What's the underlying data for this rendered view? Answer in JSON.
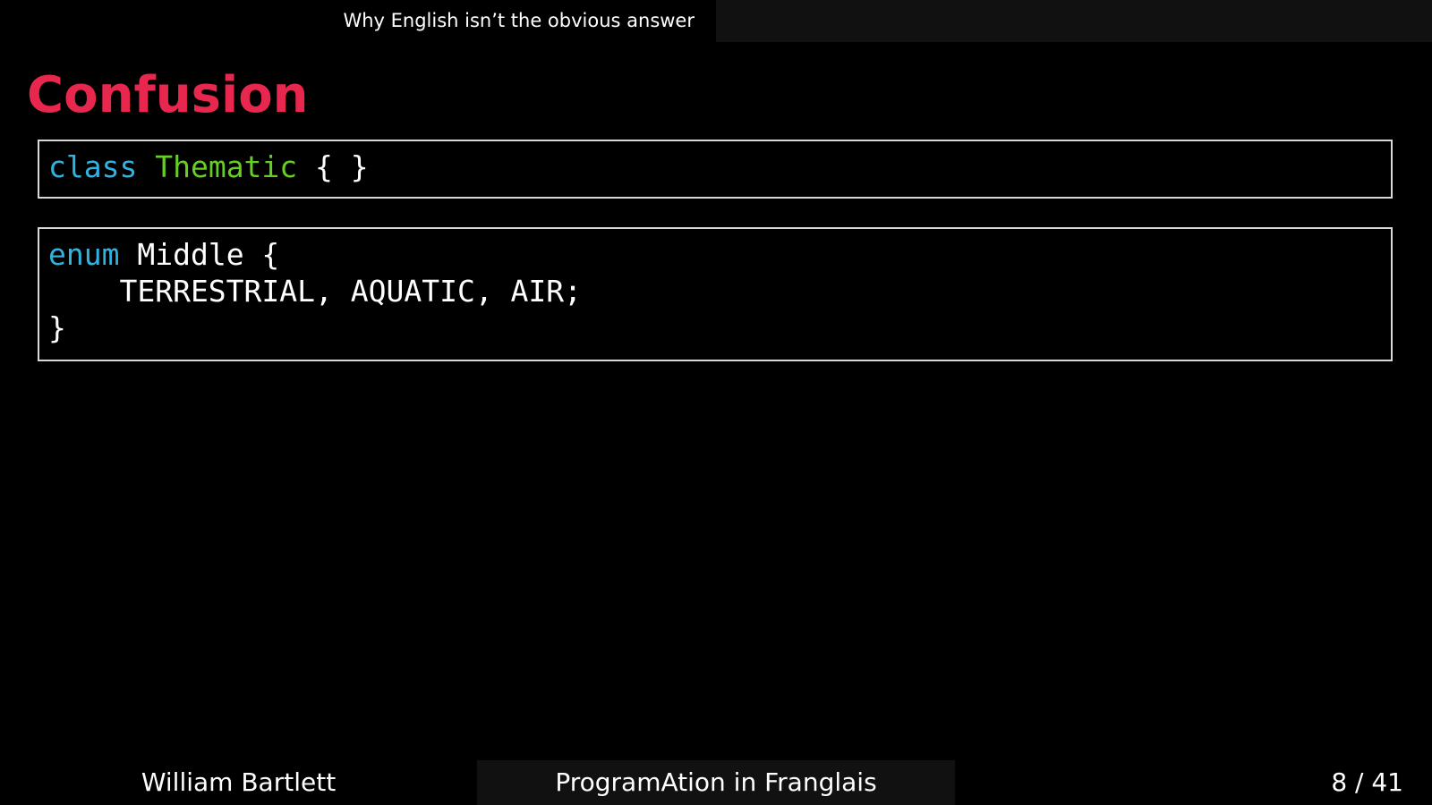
{
  "header": {
    "section_title": "Why English isn’t the obvious answer"
  },
  "slide": {
    "title": "Confusion",
    "code_block_1": {
      "keyword": "class",
      "type_name": "Thematic",
      "rest": "{ }"
    },
    "code_block_2": {
      "keyword": "enum",
      "name_line": "Middle {",
      "body_line": "    TERRESTRIAL, AQUATIC, AIR;",
      "close_line": "}"
    }
  },
  "footer": {
    "author": "William Bartlett",
    "talk_title": "ProgramAtion in Franglais",
    "page_number": "8 / 41"
  },
  "colors": {
    "title": "#e8274f",
    "keyword": "#31b3e0",
    "type": "#65cf25",
    "background": "#000000",
    "bar": "#111111"
  }
}
